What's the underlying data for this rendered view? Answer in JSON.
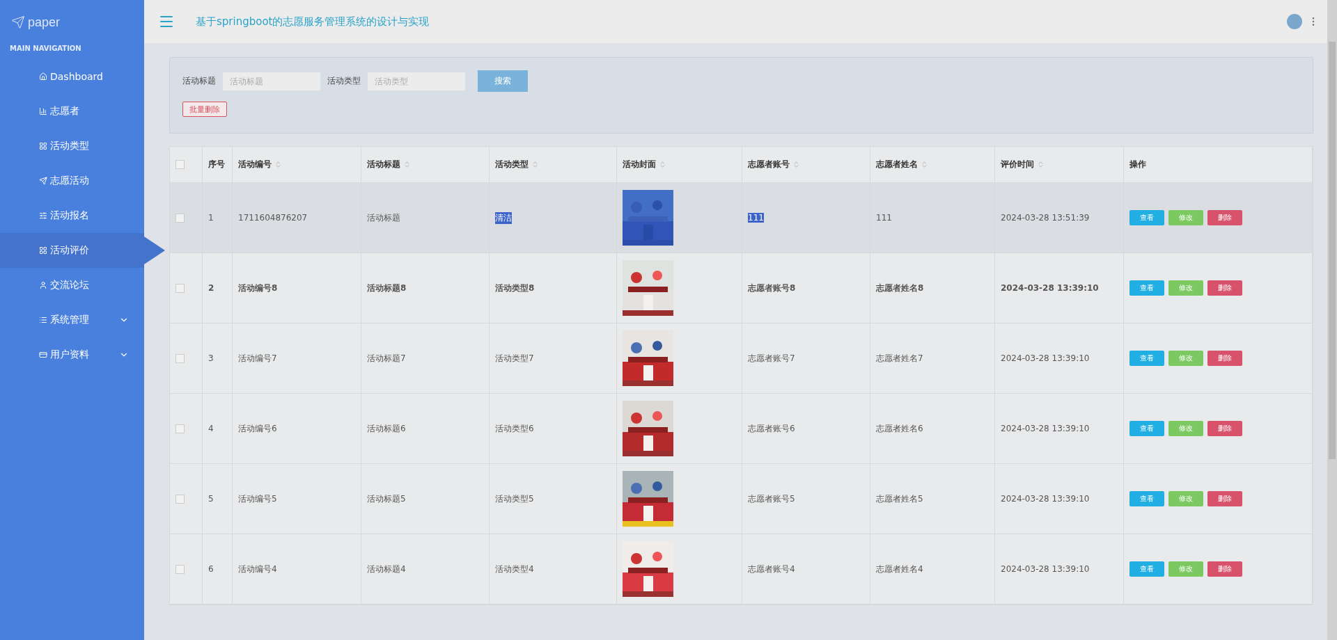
{
  "sidebar": {
    "logo": "paper",
    "section_title": "MAIN NAVIGATION",
    "items": [
      {
        "label": "Dashboard",
        "selected": false,
        "has_submenu": false
      },
      {
        "label": "志愿者",
        "selected": false,
        "has_submenu": false
      },
      {
        "label": "活动类型",
        "selected": false,
        "has_submenu": false
      },
      {
        "label": "志愿活动",
        "selected": false,
        "has_submenu": false
      },
      {
        "label": "活动报名",
        "selected": false,
        "has_submenu": false
      },
      {
        "label": "活动评价",
        "selected": true,
        "has_submenu": false
      },
      {
        "label": "交流论坛",
        "selected": false,
        "has_submenu": false
      },
      {
        "label": "系统管理",
        "selected": false,
        "has_submenu": true
      },
      {
        "label": "用户资料",
        "selected": false,
        "has_submenu": true
      }
    ]
  },
  "header": {
    "title": "基于springboot的志愿服务管理系统的设计与实现"
  },
  "search": {
    "fields": [
      {
        "label": "活动标题",
        "placeholder": "活动标题"
      },
      {
        "label": "活动类型",
        "placeholder": "活动类型"
      }
    ],
    "search_button": "搜索",
    "batch_delete_button": "批量删除"
  },
  "table": {
    "select_all_checked": false,
    "columns": [
      {
        "label": "序号",
        "sortable": false
      },
      {
        "label": "活动编号",
        "sortable": true
      },
      {
        "label": "活动标题",
        "sortable": true
      },
      {
        "label": "活动类型",
        "sortable": true
      },
      {
        "label": "活动封面",
        "sortable": true
      },
      {
        "label": "志愿者账号",
        "sortable": true
      },
      {
        "label": "志愿者姓名",
        "sortable": true
      },
      {
        "label": "评价时间",
        "sortable": true
      },
      {
        "label": "操作",
        "sortable": false
      }
    ],
    "rows": [
      {
        "index": "1",
        "code": "1711604876207",
        "title": "活动标题",
        "type": "清洁",
        "account": "111",
        "name": "111",
        "time": "2024-03-28 13:51:39",
        "actions": [
          "查看",
          "修改",
          "删除"
        ],
        "checked": false,
        "hovered": true,
        "bold": false,
        "text_selected": true
      },
      {
        "index": "2",
        "code": "活动编号8",
        "title": "活动标题8",
        "type": "活动类型8",
        "account": "志愿者账号8",
        "name": "志愿者姓名8",
        "time": "2024-03-28 13:39:10",
        "actions": [
          "查看",
          "修改",
          "删除"
        ],
        "checked": false,
        "hovered": false,
        "bold": true,
        "text_selected": false
      },
      {
        "index": "3",
        "code": "活动编号7",
        "title": "活动标题7",
        "type": "活动类型7",
        "account": "志愿者账号7",
        "name": "志愿者姓名7",
        "time": "2024-03-28 13:39:10",
        "actions": [
          "查看",
          "修改",
          "删除"
        ],
        "checked": false,
        "hovered": false,
        "bold": false,
        "text_selected": false
      },
      {
        "index": "4",
        "code": "活动编号6",
        "title": "活动标题6",
        "type": "活动类型6",
        "account": "志愿者账号6",
        "name": "志愿者姓名6",
        "time": "2024-03-28 13:39:10",
        "actions": [
          "查看",
          "修改",
          "删除"
        ],
        "checked": false,
        "hovered": false,
        "bold": false,
        "text_selected": false
      },
      {
        "index": "5",
        "code": "活动编号5",
        "title": "活动标题5",
        "type": "活动类型5",
        "account": "志愿者账号5",
        "name": "志愿者姓名5",
        "time": "2024-03-28 13:39:10",
        "actions": [
          "查看",
          "修改",
          "删除"
        ],
        "checked": false,
        "hovered": false,
        "bold": false,
        "text_selected": false
      },
      {
        "index": "6",
        "code": "活动编号4",
        "title": "活动标题4",
        "type": "活动类型4",
        "account": "志愿者账号4",
        "name": "志愿者姓名4",
        "time": "2024-03-28 13:39:10",
        "actions": [
          "查看",
          "修改",
          "删除"
        ],
        "checked": false,
        "hovered": false,
        "bold": false,
        "text_selected": false
      }
    ]
  }
}
